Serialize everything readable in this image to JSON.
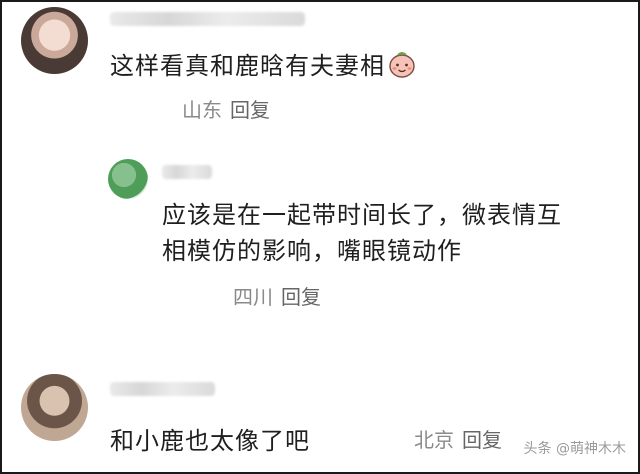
{
  "comments": [
    {
      "text": "这样看真和鹿晗有夫妻相",
      "location": "山东",
      "reply_label": "回复",
      "emoji": "smiling-face-emoji"
    },
    {
      "text_line1": "应该是在一起带时间长了，微表情互",
      "text_line2": "相模仿的影响，嘴眼镜动作",
      "location": "四川",
      "reply_label": "回复"
    },
    {
      "text": "和小鹿也太像了吧",
      "location": "北京",
      "reply_label": "回复"
    }
  ],
  "watermark": "头条 @萌神木木"
}
